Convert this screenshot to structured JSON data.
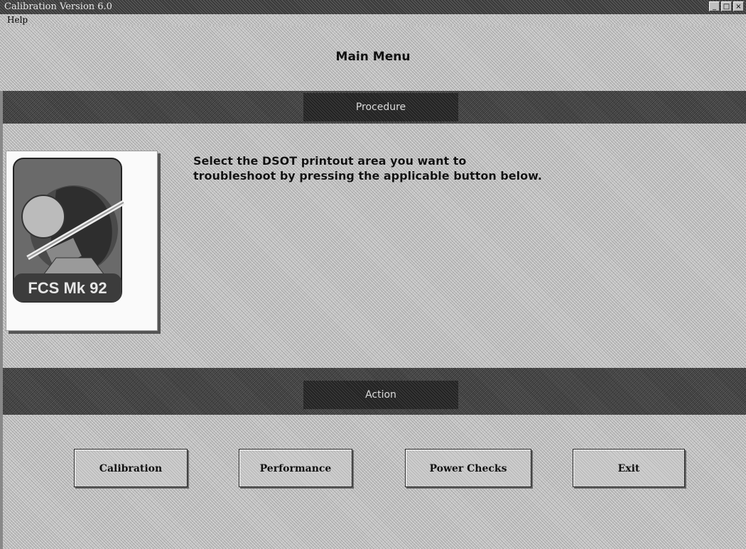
{
  "window": {
    "title": "Calibration Version 6.0",
    "controls": {
      "minimize": "_",
      "maximize": "□",
      "close": "×"
    }
  },
  "menubar": {
    "items": [
      {
        "label": "Help"
      }
    ]
  },
  "main": {
    "title": "Main Menu"
  },
  "procedure": {
    "band_label": "Procedure",
    "logo_text": "FCS Mk 92",
    "instructions": "Select the DSOT printout area you want to troubleshoot by pressing the applicable button below."
  },
  "action": {
    "band_label": "Action",
    "buttons": [
      {
        "label": "Calibration"
      },
      {
        "label": "Performance"
      },
      {
        "label": "Power Checks"
      },
      {
        "label": "Exit"
      }
    ]
  },
  "colors": {
    "band": "#444444",
    "band_label_bg": "#222222",
    "background": "#c9c9c9"
  }
}
